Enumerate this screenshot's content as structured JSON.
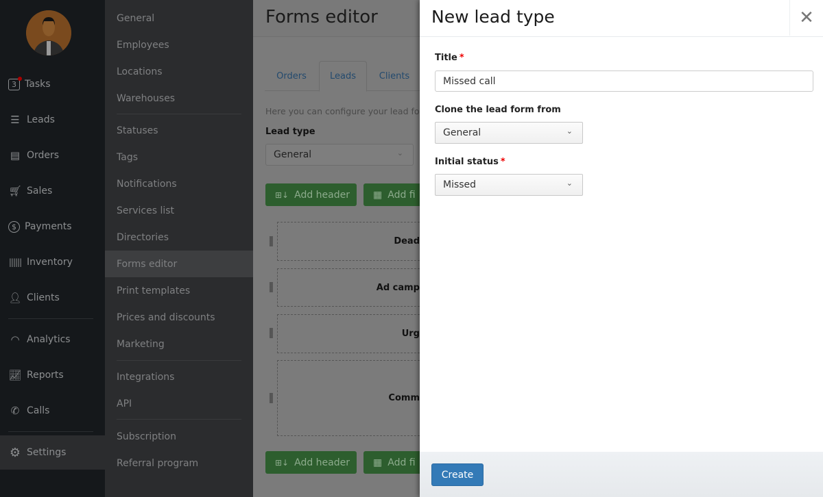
{
  "nav": {
    "tasks_count": "3",
    "items": [
      {
        "label": "Tasks",
        "icon": "calendar-icon"
      },
      {
        "label": "Leads",
        "icon": "funnel-icon"
      },
      {
        "label": "Orders",
        "icon": "register-icon"
      },
      {
        "label": "Sales",
        "icon": "cart-icon"
      },
      {
        "label": "Payments",
        "icon": "dollar-icon"
      },
      {
        "label": "Inventory",
        "icon": "barcode-icon"
      },
      {
        "label": "Clients",
        "icon": "person-icon"
      },
      {
        "label": "Analytics",
        "icon": "gauge-icon"
      },
      {
        "label": "Reports",
        "icon": "chart-icon"
      },
      {
        "label": "Calls",
        "icon": "phone-icon"
      },
      {
        "label": "Settings",
        "icon": "gear-icon"
      }
    ],
    "active": "Settings"
  },
  "submenu": {
    "items": [
      "General",
      "Employees",
      "Locations",
      "Warehouses",
      "Statuses",
      "Tags",
      "Notifications",
      "Services list",
      "Directories",
      "Forms editor",
      "Print templates",
      "Prices and discounts",
      "Marketing",
      "Integrations",
      "API",
      "Subscription",
      "Referral program"
    ],
    "active": "Forms editor"
  },
  "main": {
    "title": "Forms editor",
    "tabs": [
      "Orders",
      "Leads",
      "Clients"
    ],
    "active_tab": "Leads",
    "description": "Here you can configure your lead forr",
    "lead_type_label": "Lead type",
    "lead_type_value": "General",
    "add_header": "Add header",
    "add_field": "Add fi",
    "fields": [
      "Dead",
      "Ad camp",
      "Urg",
      "Comm"
    ]
  },
  "panel": {
    "title": "New lead type",
    "title_label": "Title",
    "title_value": "Missed call",
    "clone_label": "Clone the lead form from",
    "clone_value": "General",
    "status_label": "Initial status",
    "status_value": "Missed",
    "required_mark": "*",
    "create": "Create",
    "colors": {
      "primary": "#337ab7",
      "required": "#e00000",
      "success": "#2d5e2e"
    }
  }
}
